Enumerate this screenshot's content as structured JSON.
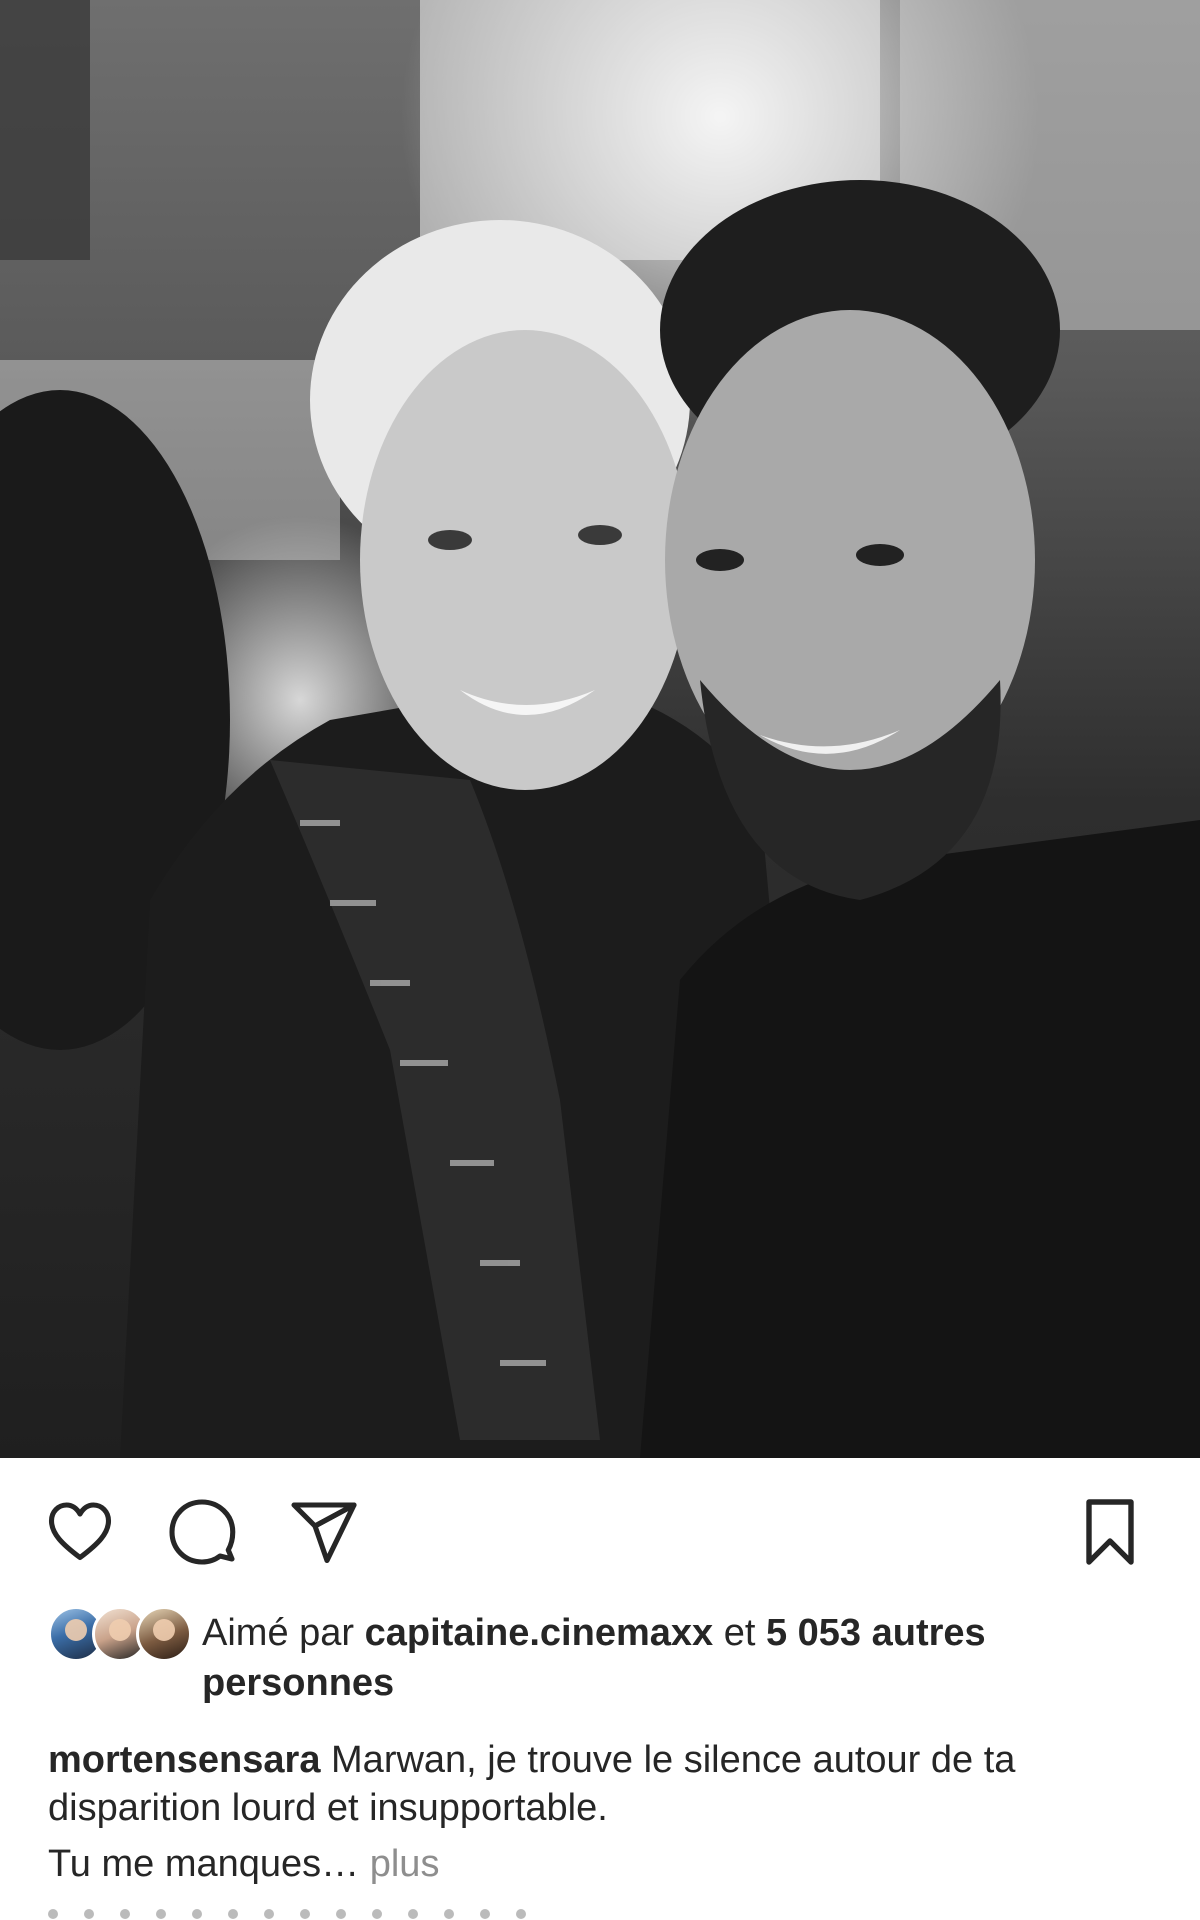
{
  "post": {
    "photo": {
      "alt": "",
      "description_icon": "photo"
    },
    "actions": {
      "like_icon": "heart-outline-icon",
      "comment_icon": "comment-bubble-icon",
      "share_icon": "paper-plane-icon",
      "save_icon": "bookmark-outline-icon"
    },
    "likes": {
      "prefix": "Aimé par",
      "liked_by_user": "capitaine.cinemaxx",
      "connector": "et",
      "others_count": "5 053 autres",
      "others_word": "personnes"
    },
    "caption": {
      "username": "mortensensara",
      "text_line1": "Marwan, je trouve le silence autour de ta disparition lourd et insupportable.",
      "text_line2": "Tu me manques…",
      "more_label": "plus"
    }
  },
  "colors": {
    "text": "#262626",
    "muted": "#8e8e8e",
    "background": "#ffffff"
  }
}
